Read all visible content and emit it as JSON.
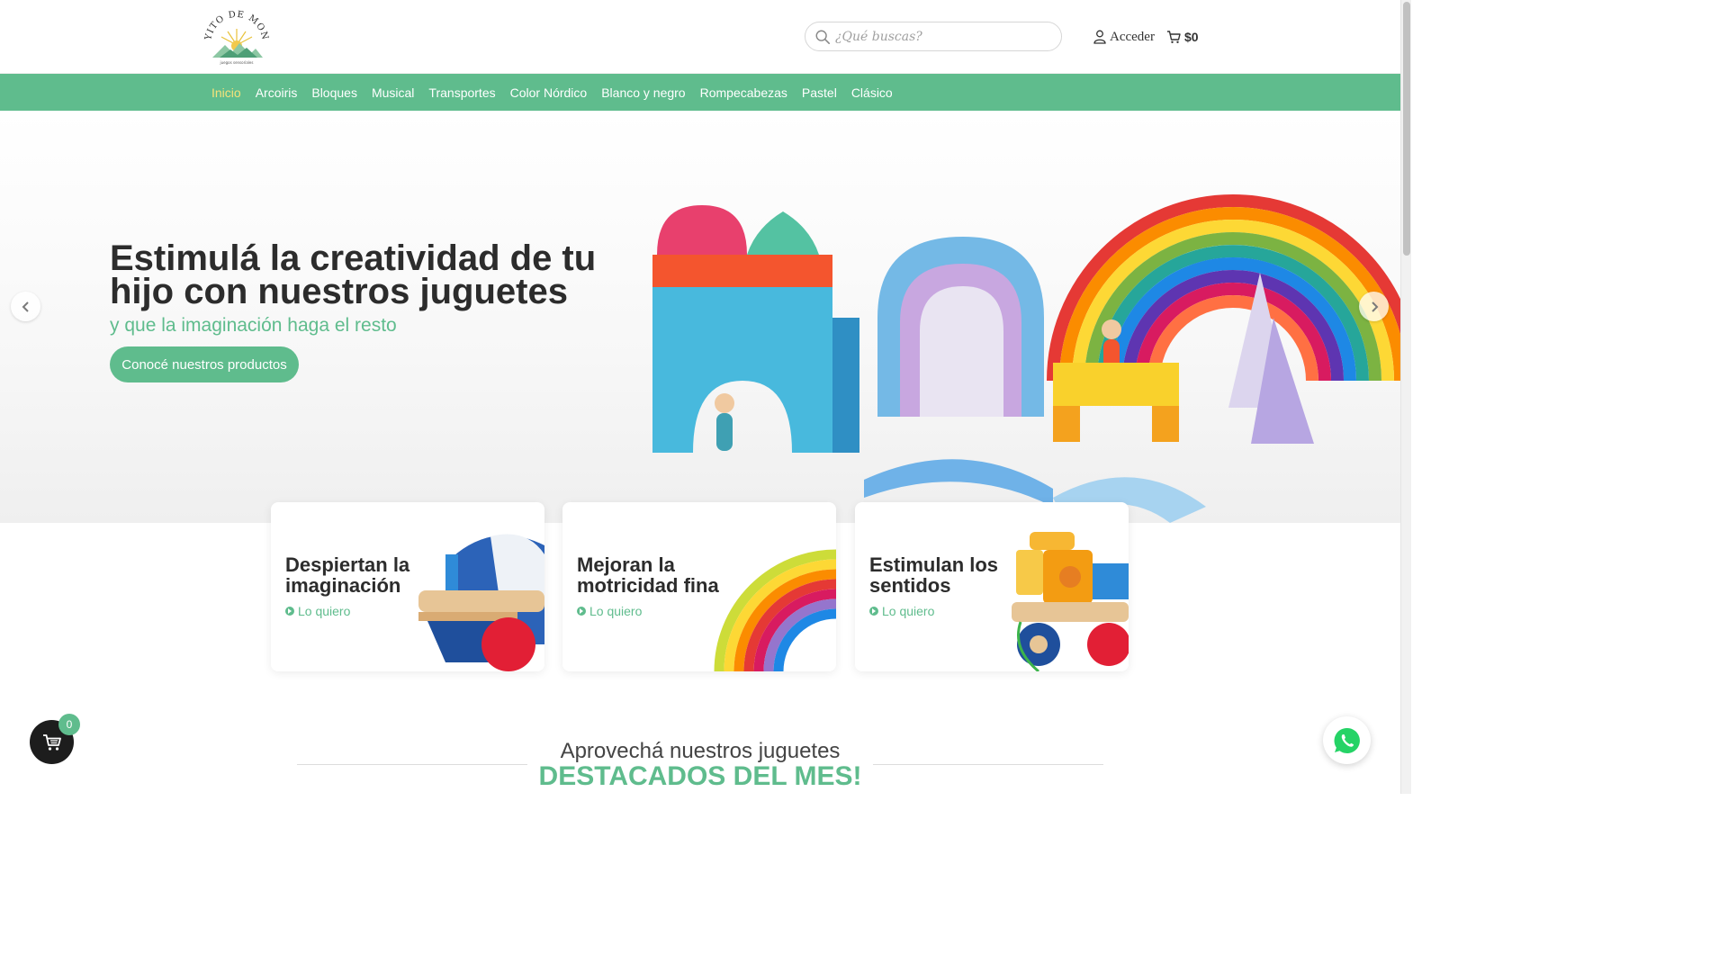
{
  "header": {
    "logo_text": "RAYITO DE MONTE",
    "logo_tagline": "juegos sensoriales",
    "search_placeholder": "¿Qué buscas?",
    "login_label": "Acceder",
    "cart_total": "$0"
  },
  "nav": {
    "items": [
      {
        "label": "Inicio",
        "active": true
      },
      {
        "label": "Arcoiris"
      },
      {
        "label": "Bloques"
      },
      {
        "label": "Musical"
      },
      {
        "label": "Transportes"
      },
      {
        "label": "Color Nórdico"
      },
      {
        "label": "Blanco y negro"
      },
      {
        "label": "Rompecabezas"
      },
      {
        "label": "Pastel"
      },
      {
        "label": "Clásico"
      }
    ]
  },
  "hero": {
    "title": "Estimulá la creatividad de tu hijo con nuestros juguetes",
    "subtitle": "y que la imaginación haga el resto",
    "cta_label": "Conocé nuestros productos",
    "prev_icon": "chevron-left-icon",
    "next_icon": "chevron-right-icon"
  },
  "features": [
    {
      "title": "Despiertan la imaginación",
      "link": "Lo quiero",
      "image": "wooden-boat-toy"
    },
    {
      "title": "Mejoran la motricidad fina",
      "link": "Lo quiero",
      "image": "rainbow-stacker-toy"
    },
    {
      "title": "Estimulan los sentidos",
      "link": "Lo quiero",
      "image": "wooden-truck-toy"
    }
  ],
  "section": {
    "kicker": "Aprovechá nuestros juguetes",
    "title": "DESTACADOS DEL MES!"
  },
  "floating": {
    "cart_count": "0",
    "whatsapp_icon": "whatsapp-icon"
  },
  "colors": {
    "brand_green": "#5fbc8d",
    "nav_active": "#f6e27a",
    "text_dark": "#2c2c2c"
  }
}
